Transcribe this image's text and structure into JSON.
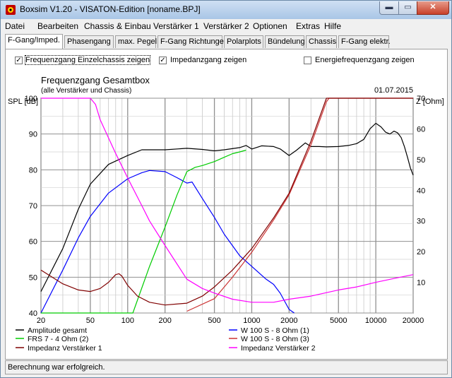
{
  "window": {
    "title": "Boxsim V1.20 - VISATON-Edition [noname.BPJ]",
    "controls": {
      "minimize": "▬",
      "maximize": "▭",
      "close": "✕"
    }
  },
  "menu": [
    "Datei",
    "Bearbeiten",
    "Chassis & Einbau",
    "Verstärker 1",
    "Verstärker 2",
    "Optionen",
    "Extras",
    "Hilfe"
  ],
  "tabs": [
    "F-Gang/Imped.",
    "Phasengang",
    "max. Pegel",
    "F-Gang Richtungen",
    "Polarplots",
    "Bündelung",
    "Chassis",
    "F-Gang elektr."
  ],
  "active_tab": 0,
  "options": [
    {
      "label": "Frequenzgang Einzelchassis zeigen",
      "checked": true
    },
    {
      "label": "Impedanzgang zeigen",
      "checked": true
    },
    {
      "label": "Energiefrequenzgang zeigen",
      "checked": false
    }
  ],
  "status": "Berechnung war erfolgreich.",
  "colors": {
    "panel_bg": "#ffffff",
    "grid": "#a0a0a0"
  },
  "chart_data": {
    "type": "line",
    "title": "Frequenzgang Gesamtbox",
    "subtitle": "(alle Verstärker und Chassis)",
    "date": "01.07.2015",
    "ylabel_left": "SPL [dB]",
    "ylabel_right": "Z [Ohm]",
    "x_scale": "log",
    "xlim": [
      20,
      20000
    ],
    "ylim_left": [
      40,
      100
    ],
    "ylim_right": [
      0,
      70
    ],
    "x_ticks": [
      20,
      50,
      100,
      200,
      500,
      1000,
      2000,
      5000,
      10000,
      20000
    ],
    "y_ticks_left": [
      40,
      50,
      60,
      70,
      80,
      90,
      100
    ],
    "y_ticks_right": [
      10,
      20,
      30,
      40,
      50,
      60,
      70
    ],
    "grid": true,
    "series": [
      {
        "name": "Amplitude gesamt",
        "color": "#000000",
        "axis": "left",
        "points": [
          [
            20,
            46
          ],
          [
            30,
            58
          ],
          [
            40,
            69
          ],
          [
            50,
            76
          ],
          [
            70,
            81.5
          ],
          [
            100,
            84
          ],
          [
            130,
            85.6
          ],
          [
            200,
            85.6
          ],
          [
            300,
            86
          ],
          [
            400,
            85.7
          ],
          [
            500,
            85.3
          ],
          [
            600,
            85.6
          ],
          [
            800,
            86.2
          ],
          [
            900,
            86.8
          ],
          [
            1000,
            85.8
          ],
          [
            1200,
            86.7
          ],
          [
            1500,
            86.5
          ],
          [
            1700,
            85.8
          ],
          [
            2000,
            84
          ],
          [
            2300,
            85.5
          ],
          [
            2700,
            87.5
          ],
          [
            3000,
            86.5
          ],
          [
            3500,
            86.5
          ],
          [
            4000,
            86.4
          ],
          [
            5000,
            86.5
          ],
          [
            6000,
            86.8
          ],
          [
            7000,
            87.3
          ],
          [
            8000,
            88.5
          ],
          [
            9000,
            91.5
          ],
          [
            10000,
            93
          ],
          [
            11000,
            92
          ],
          [
            12000,
            90.5
          ],
          [
            13000,
            90
          ],
          [
            14000,
            90.8
          ],
          [
            15000,
            90.3
          ],
          [
            16000,
            89
          ],
          [
            17000,
            86.5
          ],
          [
            18000,
            83.5
          ],
          [
            19000,
            80.5
          ],
          [
            20000,
            78.5
          ]
        ]
      },
      {
        "name": "W 100 S - 8 Ohm (1)",
        "color": "#0000ff",
        "axis": "left",
        "points": [
          [
            20,
            40
          ],
          [
            30,
            52
          ],
          [
            40,
            61
          ],
          [
            50,
            67
          ],
          [
            70,
            73.5
          ],
          [
            100,
            77.5
          ],
          [
            130,
            79.2
          ],
          [
            150,
            79.8
          ],
          [
            200,
            79.5
          ],
          [
            250,
            77.8
          ],
          [
            300,
            76.3
          ],
          [
            330,
            76.6
          ],
          [
            400,
            72
          ],
          [
            500,
            66.7
          ],
          [
            600,
            62
          ],
          [
            800,
            56
          ],
          [
            1000,
            53
          ],
          [
            1300,
            49.5
          ],
          [
            1500,
            48
          ],
          [
            1700,
            45.5
          ],
          [
            2000,
            41
          ],
          [
            2200,
            40
          ]
        ]
      },
      {
        "name": "FRS 7 - 4 Ohm (2)",
        "color": "#00cc00",
        "axis": "left",
        "points": [
          [
            20,
            40
          ],
          [
            100,
            40
          ],
          [
            110,
            40
          ],
          [
            130,
            47
          ],
          [
            150,
            53
          ],
          [
            200,
            64
          ],
          [
            250,
            73
          ],
          [
            300,
            79.5
          ],
          [
            350,
            80.7
          ],
          [
            400,
            81.2
          ],
          [
            500,
            82.3
          ],
          [
            600,
            83.5
          ],
          [
            700,
            84.5
          ],
          [
            800,
            85
          ],
          [
            900,
            85.5
          ]
        ]
      },
      {
        "name": "W 100 S - 8 Ohm (3)",
        "color": "#cc3333",
        "axis": "left",
        "points": [
          [
            300,
            40.5
          ],
          [
            500,
            44
          ],
          [
            700,
            50
          ],
          [
            1000,
            57
          ],
          [
            1500,
            66
          ],
          [
            2000,
            73
          ],
          [
            3000,
            87
          ],
          [
            4000,
            99
          ],
          [
            4200,
            100
          ],
          [
            20000,
            100
          ]
        ]
      },
      {
        "name": "Impedanz Verstärker 1",
        "color": "#800000",
        "axis": "right",
        "points": [
          [
            20,
            14
          ],
          [
            30,
            9.5
          ],
          [
            40,
            7.5
          ],
          [
            50,
            7
          ],
          [
            60,
            8
          ],
          [
            70,
            10
          ],
          [
            80,
            12.5
          ],
          [
            85,
            12.8
          ],
          [
            90,
            12
          ],
          [
            100,
            9
          ],
          [
            120,
            5.5
          ],
          [
            150,
            3.5
          ],
          [
            200,
            2.6
          ],
          [
            300,
            3.2
          ],
          [
            400,
            5.5
          ],
          [
            500,
            8.5
          ],
          [
            700,
            14
          ],
          [
            1000,
            21
          ],
          [
            1500,
            31
          ],
          [
            2000,
            39
          ],
          [
            3000,
            56
          ],
          [
            4000,
            70
          ],
          [
            20000,
            70
          ]
        ]
      },
      {
        "name": "Impedanz Verstärker 2",
        "color": "#ff00ff",
        "axis": "right",
        "points": [
          [
            20,
            70
          ],
          [
            50,
            70
          ],
          [
            55,
            68
          ],
          [
            60,
            63
          ],
          [
            80,
            52
          ],
          [
            100,
            44
          ],
          [
            130,
            35
          ],
          [
            150,
            30
          ],
          [
            200,
            22
          ],
          [
            300,
            11
          ],
          [
            400,
            8
          ],
          [
            500,
            6.5
          ],
          [
            700,
            4.5
          ],
          [
            1000,
            3.5
          ],
          [
            1500,
            3.5
          ],
          [
            2000,
            4.5
          ],
          [
            3000,
            5.5
          ],
          [
            5000,
            7.5
          ],
          [
            7000,
            8.5
          ],
          [
            10000,
            10
          ],
          [
            15000,
            11.5
          ],
          [
            20000,
            12.5
          ]
        ]
      }
    ],
    "legend": [
      "Amplitude gesamt",
      "W 100 S - 8 Ohm (1)",
      "FRS 7 - 4 Ohm (2)",
      "W 100 S - 8 Ohm (3)",
      "Impedanz Verstärker 1",
      "Impedanz Verstärker 2"
    ]
  }
}
